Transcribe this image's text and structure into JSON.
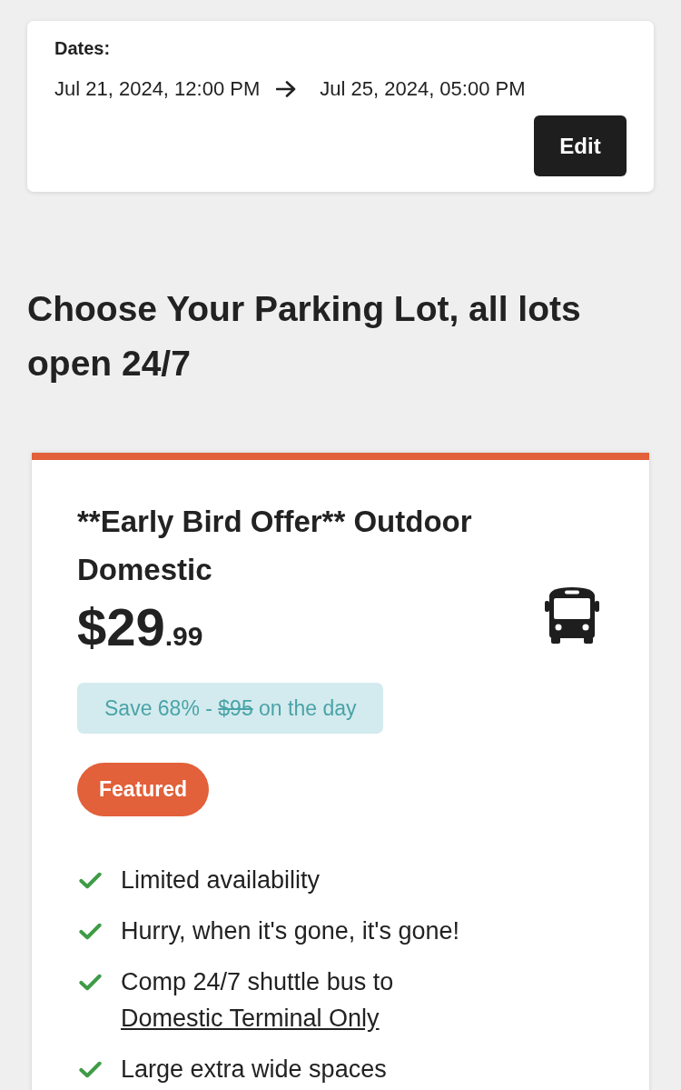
{
  "dates_card": {
    "label": "Dates:",
    "start": "Jul 21, 2024, 12:00 PM",
    "end": "Jul 25, 2024, 05:00 PM",
    "edit_button": "Edit"
  },
  "heading": "Choose Your Parking Lot, all lots open 24/7",
  "lots": [
    {
      "title": "**Early Bird Offer** Outdoor Domestic",
      "price_main": "$29",
      "price_cents": ".99",
      "savings": {
        "prefix": "Save 68% - ",
        "old_price": "$95",
        "suffix": " on the day"
      },
      "badge": "Featured",
      "features": [
        {
          "text": "Limited availability"
        },
        {
          "text": "Hurry, when it's gone, it's gone!"
        },
        {
          "text": "Comp 24/7 shuttle bus to ",
          "link": "Domestic Terminal Only"
        },
        {
          "text": "Large extra wide spaces"
        }
      ]
    }
  ]
}
